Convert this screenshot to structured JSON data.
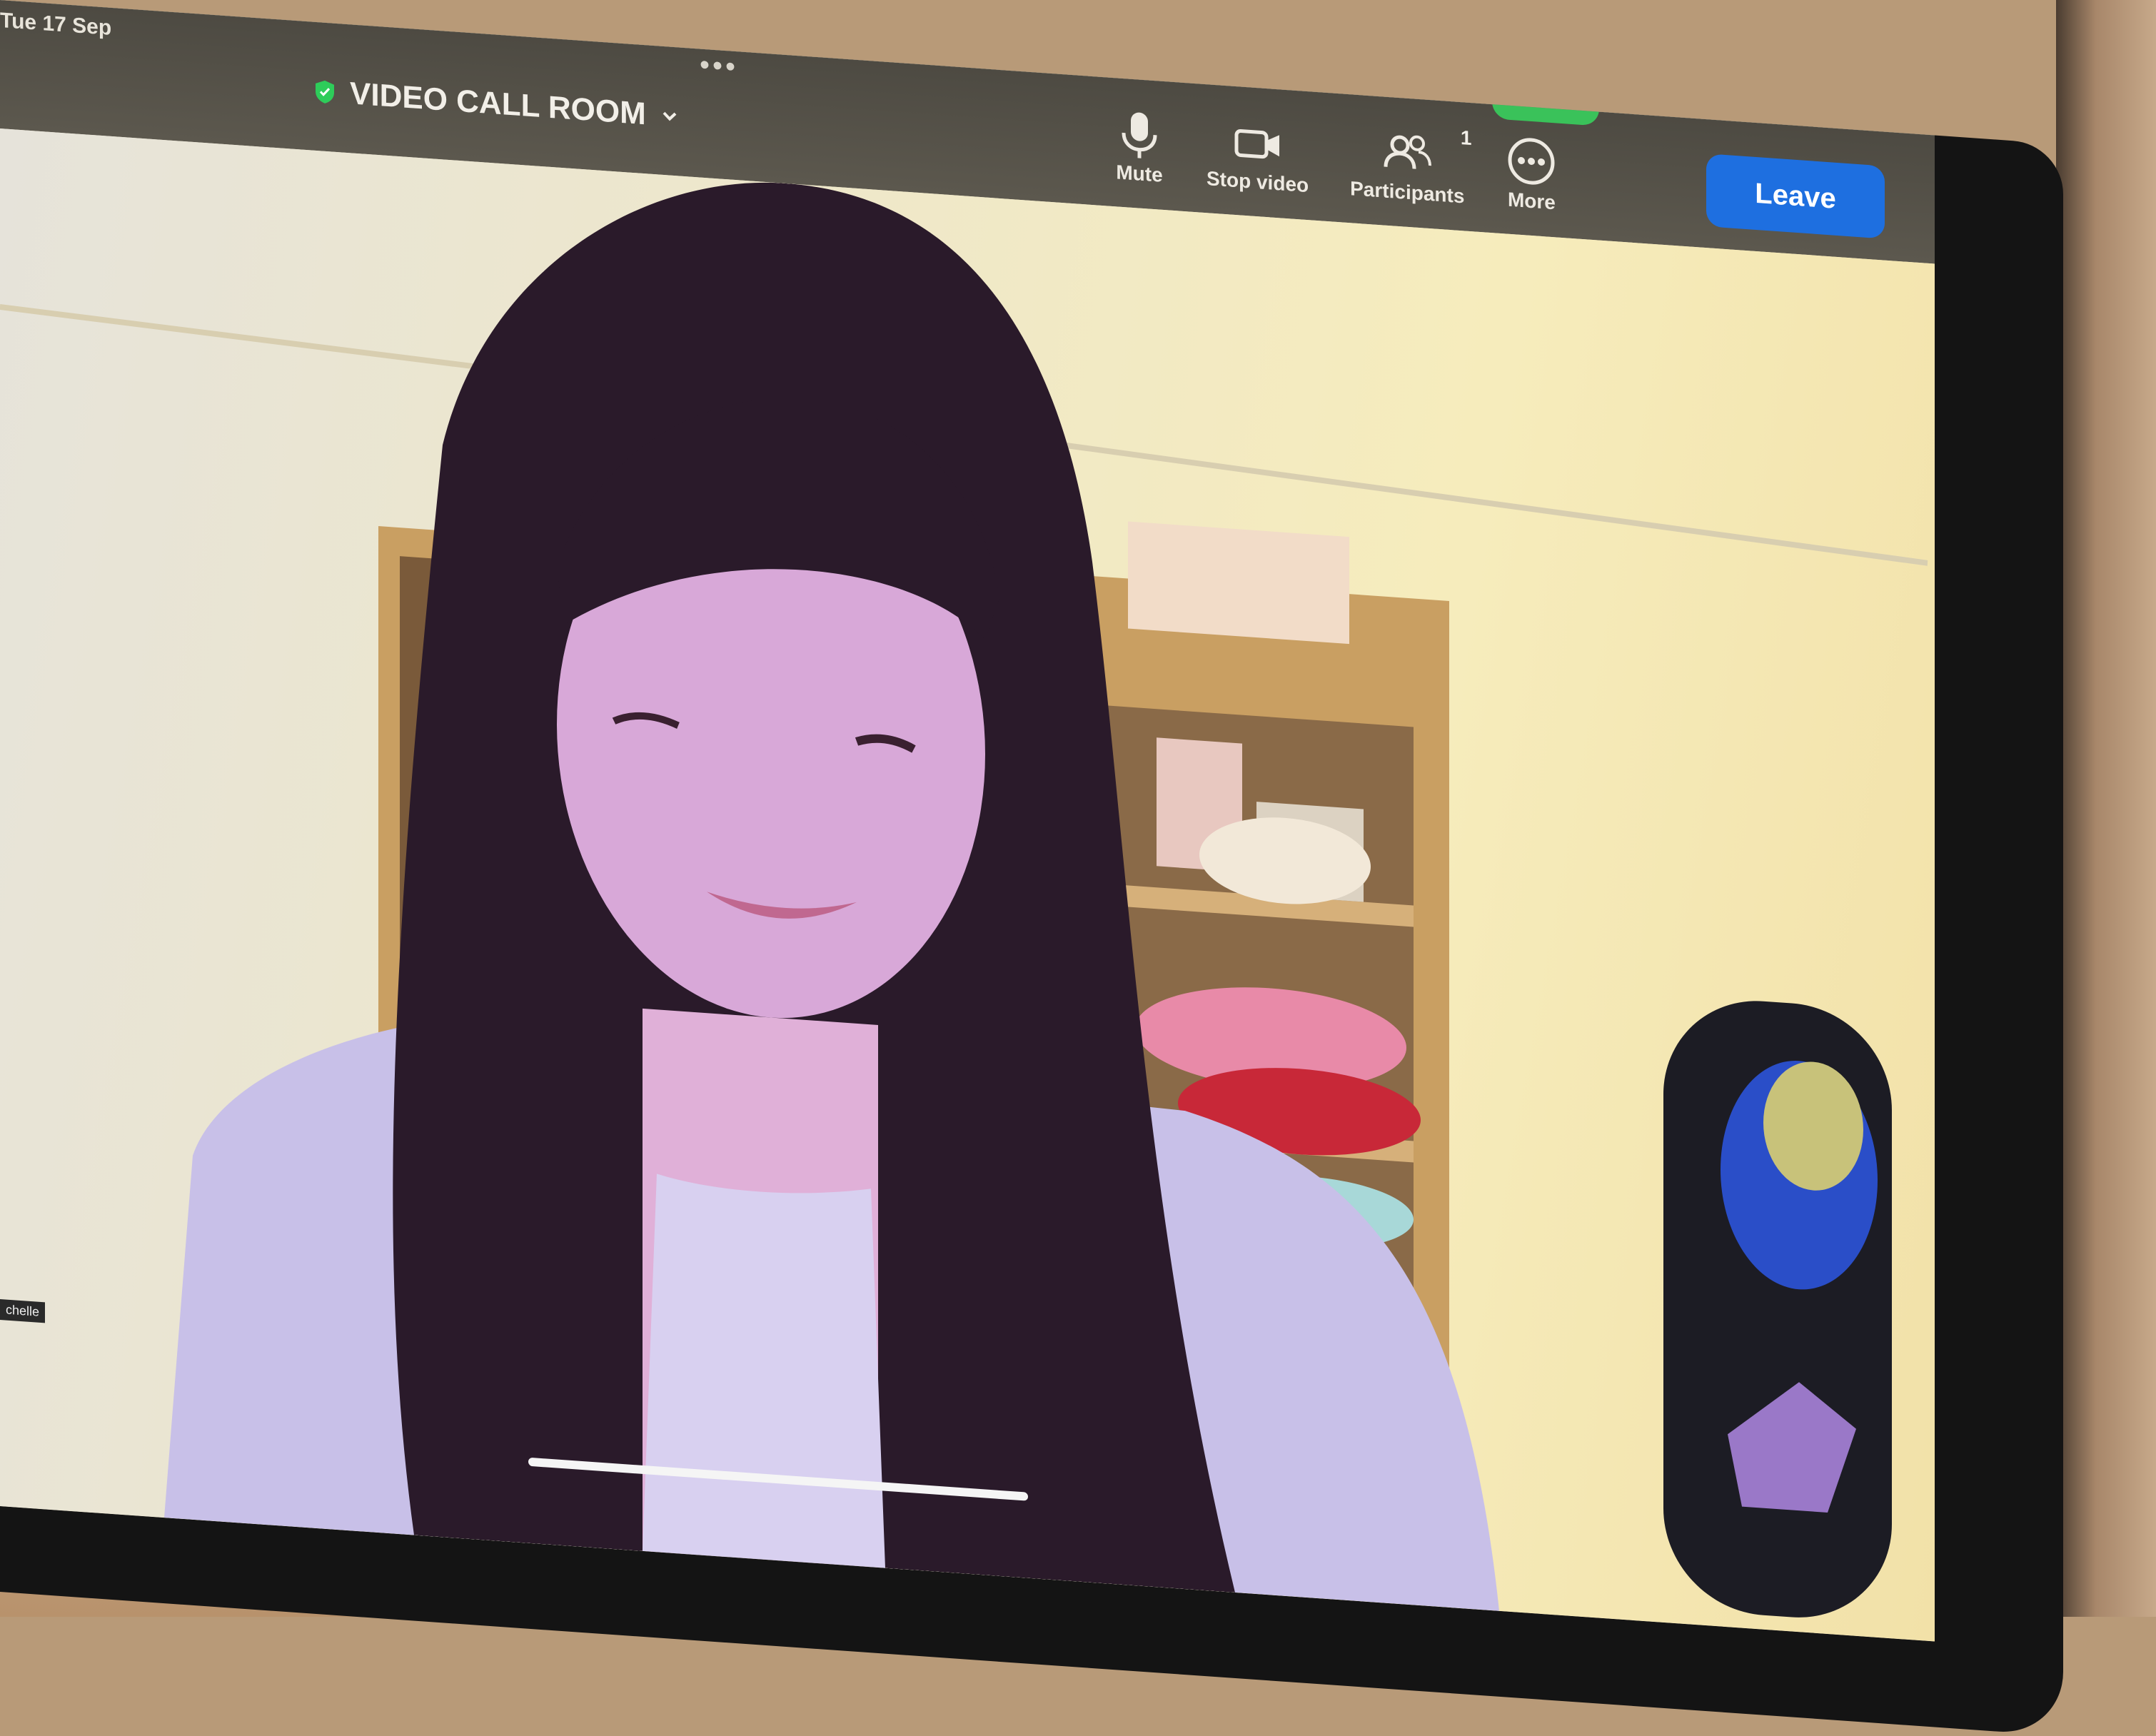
{
  "status_bar": {
    "date": "Tue 17 Sep",
    "dots": "•••"
  },
  "meeting": {
    "title": "VIDEO CALL ROOM"
  },
  "toolbar": {
    "mute_label": "Mute",
    "stop_video_label": "Stop video",
    "participants_label": "Participants",
    "participants_count": "1",
    "more_label": "More",
    "leave_label": "Leave"
  },
  "video": {
    "participant_name": "chelle"
  },
  "colors": {
    "leave_button": "#1e6fe0",
    "shield": "#2ecc5a",
    "topbar": "#55524a"
  },
  "icons": [
    "shield-icon",
    "chevron-down-icon",
    "microphone-icon",
    "video-camera-icon",
    "participants-icon",
    "more-icon"
  ]
}
